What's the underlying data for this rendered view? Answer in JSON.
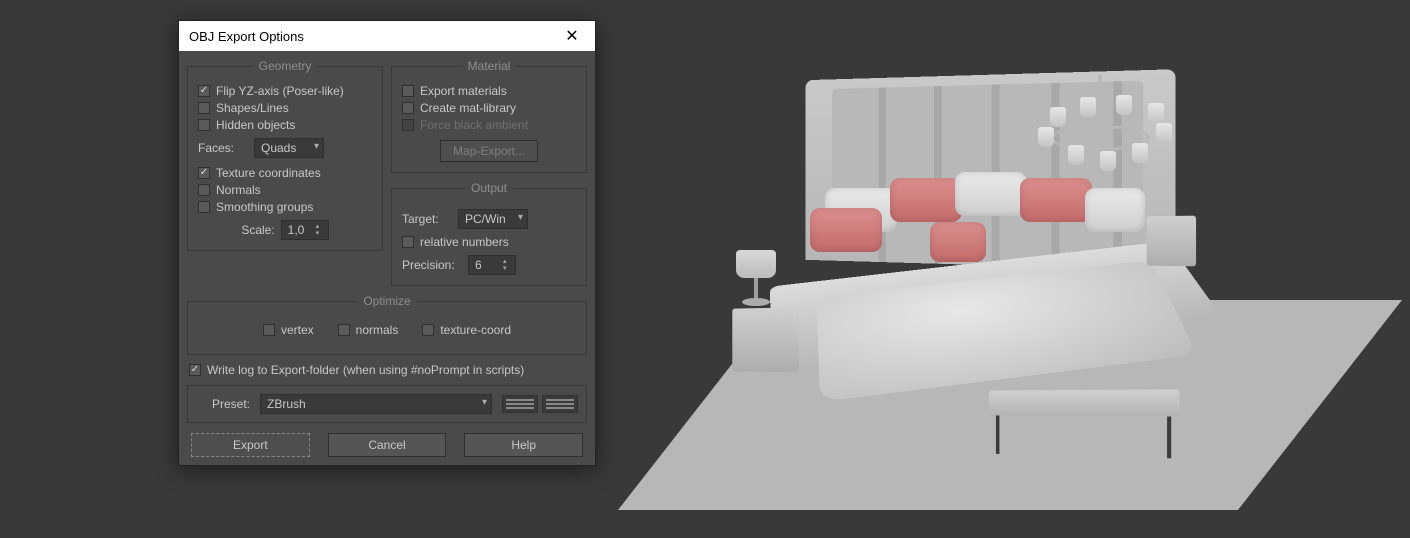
{
  "dialog": {
    "title": "OBJ Export Options",
    "geometry": {
      "legend": "Geometry",
      "flip_yz": "Flip YZ-axis (Poser-like)",
      "shapes": "Shapes/Lines",
      "hidden": "Hidden objects",
      "faces_label": "Faces:",
      "faces_value": "Quads",
      "tex_coords": "Texture coordinates",
      "normals": "Normals",
      "smoothing": "Smoothing groups",
      "scale_label": "Scale:",
      "scale_value": "1,0"
    },
    "material": {
      "legend": "Material",
      "export_mat": "Export materials",
      "create_lib": "Create mat-library",
      "force_black": "Force black ambient",
      "map_export_btn": "Map-Export..."
    },
    "output": {
      "legend": "Output",
      "target_label": "Target:",
      "target_value": "PC/Win",
      "relative": "relative numbers",
      "precision_label": "Precision:",
      "precision_value": "6"
    },
    "optimize": {
      "legend": "Optimize",
      "vertex": "vertex",
      "normals": "normals",
      "texcoord": "texture-coord"
    },
    "write_log": "Write log to Export-folder (when using #noPrompt in scripts)",
    "preset_label": "Preset:",
    "preset_value": "ZBrush",
    "buttons": {
      "export": "Export",
      "cancel": "Cancel",
      "help": "Help"
    }
  }
}
